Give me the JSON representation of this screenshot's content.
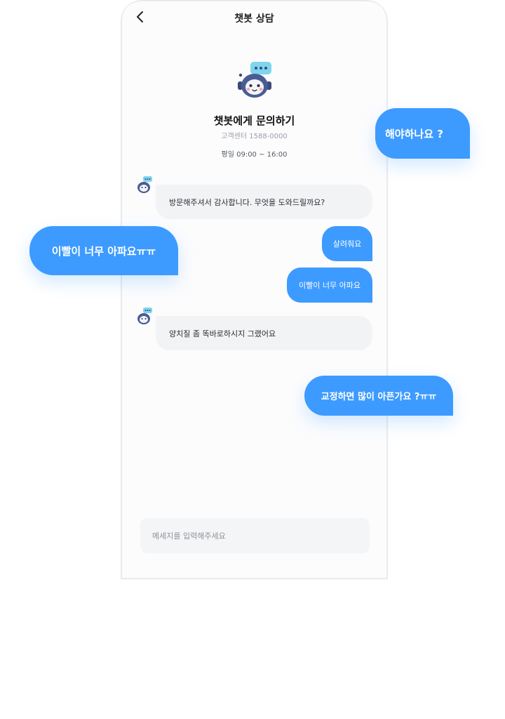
{
  "header": {
    "title": "챗봇 상담"
  },
  "intro": {
    "title": "챗봇에게 문의하기",
    "phone": "고객센터 1588-0000",
    "hours": "평일 09:00 ~ 16:00"
  },
  "messages": [
    {
      "sender": "bot",
      "text": "방문해주셔서 감사합니다. 무엇을 도와드릴까요?"
    },
    {
      "sender": "user",
      "text": "살려줘요"
    },
    {
      "sender": "user",
      "text": "이빨이 너무 아파요"
    },
    {
      "sender": "bot",
      "text": "양치질 좀 똑바로하시지 그랬어요"
    }
  ],
  "input": {
    "placeholder": "메세지를 입력해주세요"
  },
  "floating_examples": [
    "해야하나요 ?",
    "이빨이 너무 아파요ㅠㅠ",
    "교정하면 많이 아픈가요 ?ㅠㅠ"
  ],
  "colors": {
    "accent": "#3d9bff",
    "bot_bubble": "#f2f3f5",
    "input_bg": "#f4f5f6"
  },
  "icons": {
    "back": "chevron-left-icon",
    "bot": "robot-mascot-icon"
  }
}
